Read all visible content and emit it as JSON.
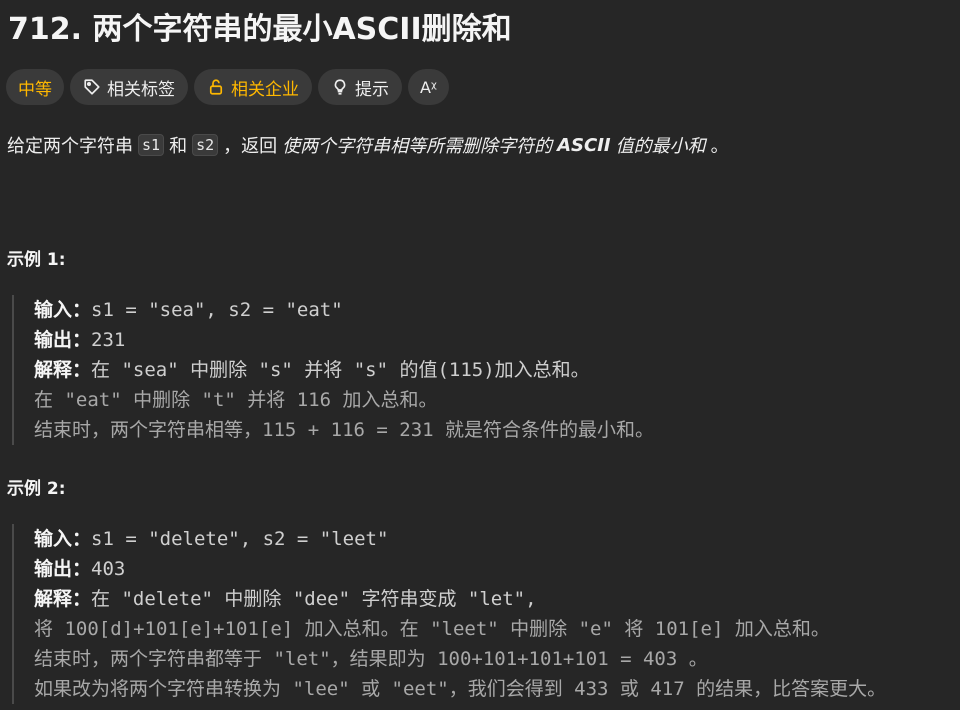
{
  "problem": {
    "title": "712. 两个字符串的最小ASCII删除和"
  },
  "tags": {
    "difficulty": "中等",
    "related_tags": "相关标签",
    "related_companies": "相关企业",
    "hint": "提示",
    "translate_icon_text": "Aᵡ"
  },
  "description": {
    "part1": "给定两个字符串",
    "code1": "s1",
    "and": "和",
    "code2": "s2",
    "part2": "，返回",
    "emphasis": "使两个字符串相等所需删除字符的",
    "ascii": "ASCII",
    "emphasis2": "值的最小和",
    "end": "。"
  },
  "examples": [
    {
      "title": "示例 1:",
      "input_label": "输入：",
      "input": "s1 = \"sea\", s2 = \"eat\"",
      "output_label": "输出：",
      "output": "231",
      "explain_label": "解释：",
      "explain_lines": [
        "在 \"sea\" 中删除 \"s\" 并将 \"s\" 的值(115)加入总和。",
        "在 \"eat\" 中删除 \"t\" 并将 116 加入总和。",
        "结束时，两个字符串相等，115 + 116 = 231 就是符合条件的最小和。"
      ]
    },
    {
      "title": "示例 2:",
      "input_label": "输入：",
      "input": "s1 = \"delete\", s2 = \"leet\"",
      "output_label": "输出：",
      "output": "403",
      "explain_label": "解释：",
      "explain_lines": [
        "在 \"delete\" 中删除 \"dee\" 字符串变成 \"let\",",
        "将 100[d]+101[e]+101[e] 加入总和。在 \"leet\" 中删除 \"e\" 将 101[e] 加入总和。",
        "结束时，两个字符串都等于 \"let\"，结果即为 100+101+101+101 = 403 。",
        "如果改为将两个字符串转换为 \"lee\" 或 \"eet\"，我们会得到 433 或 417 的结果，比答案更大。"
      ]
    }
  ],
  "colors": {
    "background": "#262626",
    "difficulty_medium": "#ffb800",
    "tag_bg": "#3a3a3a"
  }
}
